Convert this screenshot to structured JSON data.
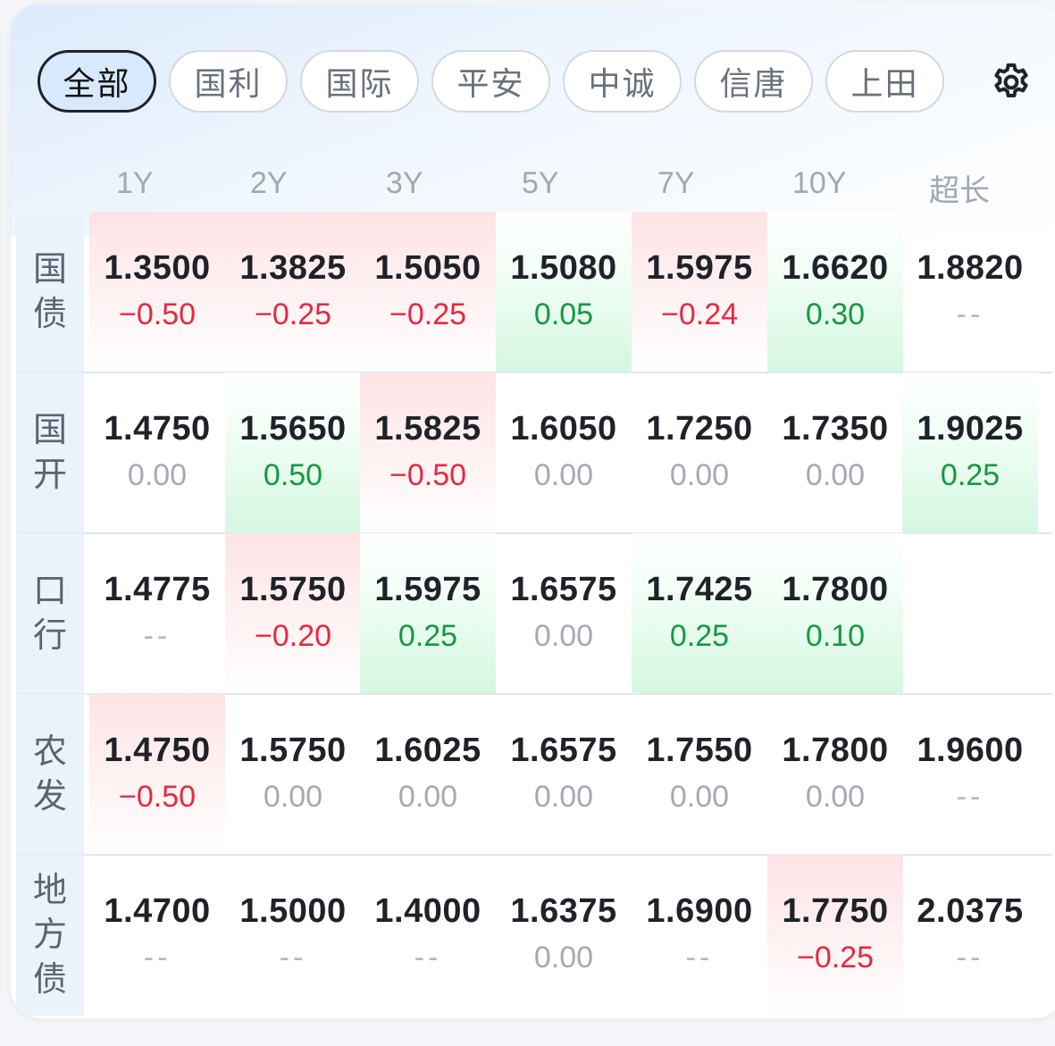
{
  "tabs": [
    "全部",
    "国利",
    "国际",
    "平安",
    "中诚",
    "信唐",
    "上田"
  ],
  "active_tab": "全部",
  "settings_icon": "gear-icon",
  "columns": [
    "1Y",
    "2Y",
    "3Y",
    "5Y",
    "7Y",
    "10Y",
    "超长"
  ],
  "colors": {
    "up_text": "#e8283f",
    "down_text": "#14993f",
    "neutral_text": "#a5aab2",
    "label_bg": "#eaf2fc"
  },
  "rows": [
    {
      "label": "国债",
      "cells": [
        {
          "rate": "1.3500",
          "change": "−0.50",
          "trend": "neg"
        },
        {
          "rate": "1.3825",
          "change": "−0.25",
          "trend": "neg"
        },
        {
          "rate": "1.5050",
          "change": "−0.25",
          "trend": "neg"
        },
        {
          "rate": "1.5080",
          "change": "0.05",
          "trend": "pos"
        },
        {
          "rate": "1.5975",
          "change": "−0.24",
          "trend": "neg"
        },
        {
          "rate": "1.6620",
          "change": "0.30",
          "trend": "pos"
        },
        {
          "rate": "1.8820",
          "change": "--",
          "trend": "none"
        }
      ]
    },
    {
      "label": "国开",
      "cells": [
        {
          "rate": "1.4750",
          "change": "0.00",
          "trend": "zero"
        },
        {
          "rate": "1.5650",
          "change": "0.50",
          "trend": "pos"
        },
        {
          "rate": "1.5825",
          "change": "−0.50",
          "trend": "neg"
        },
        {
          "rate": "1.6050",
          "change": "0.00",
          "trend": "zero"
        },
        {
          "rate": "1.7250",
          "change": "0.00",
          "trend": "zero"
        },
        {
          "rate": "1.7350",
          "change": "0.00",
          "trend": "zero"
        },
        {
          "rate": "1.9025",
          "change": "0.25",
          "trend": "pos"
        }
      ]
    },
    {
      "label": "口行",
      "cells": [
        {
          "rate": "1.4775",
          "change": "--",
          "trend": "none"
        },
        {
          "rate": "1.5750",
          "change": "−0.20",
          "trend": "neg"
        },
        {
          "rate": "1.5975",
          "change": "0.25",
          "trend": "pos"
        },
        {
          "rate": "1.6575",
          "change": "0.00",
          "trend": "zero"
        },
        {
          "rate": "1.7425",
          "change": "0.25",
          "trend": "pos"
        },
        {
          "rate": "1.7800",
          "change": "0.10",
          "trend": "pos"
        },
        {
          "rate": "",
          "change": "",
          "trend": "empty"
        }
      ]
    },
    {
      "label": "农发",
      "cells": [
        {
          "rate": "1.4750",
          "change": "−0.50",
          "trend": "neg"
        },
        {
          "rate": "1.5750",
          "change": "0.00",
          "trend": "zero"
        },
        {
          "rate": "1.6025",
          "change": "0.00",
          "trend": "zero"
        },
        {
          "rate": "1.6575",
          "change": "0.00",
          "trend": "zero"
        },
        {
          "rate": "1.7550",
          "change": "0.00",
          "trend": "zero"
        },
        {
          "rate": "1.7800",
          "change": "0.00",
          "trend": "zero"
        },
        {
          "rate": "1.9600",
          "change": "--",
          "trend": "none"
        }
      ]
    },
    {
      "label": "地方债",
      "cells": [
        {
          "rate": "1.4700",
          "change": "--",
          "trend": "none"
        },
        {
          "rate": "1.5000",
          "change": "--",
          "trend": "none"
        },
        {
          "rate": "1.4000",
          "change": "--",
          "trend": "none"
        },
        {
          "rate": "1.6375",
          "change": "0.00",
          "trend": "zero"
        },
        {
          "rate": "1.6900",
          "change": "--",
          "trend": "none"
        },
        {
          "rate": "1.7750",
          "change": "−0.25",
          "trend": "neg"
        },
        {
          "rate": "2.0375",
          "change": "--",
          "trend": "none"
        }
      ]
    }
  ]
}
